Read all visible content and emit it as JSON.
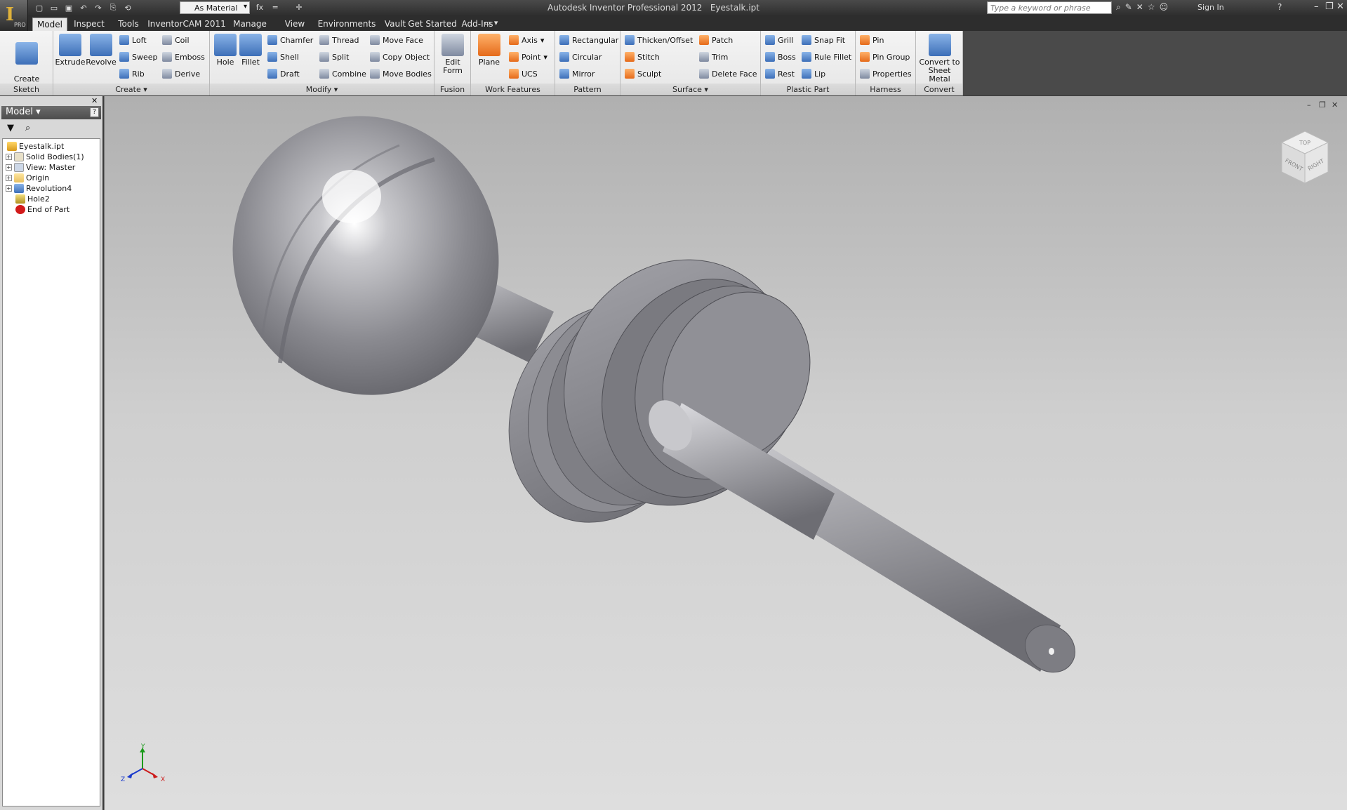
{
  "app": {
    "title": "Autodesk Inventor Professional 2012",
    "document": "Eyestalk.ipt",
    "logo_badge": "PRO",
    "material": "As Material",
    "search_placeholder": "Type a keyword or phrase",
    "sign_in": "Sign In"
  },
  "tabs": [
    "Model",
    "Inspect",
    "Tools",
    "InventorCAM 2011",
    "Manage",
    "View",
    "Environments",
    "Vault",
    "Get Started",
    "Add-Ins"
  ],
  "ribbon": {
    "sketch": {
      "label": "Sketch",
      "create_2d_sketch": "Create\n2D Sketch"
    },
    "create": {
      "label": "Create",
      "extrude": "Extrude",
      "revolve": "Revolve",
      "loft": "Loft",
      "sweep": "Sweep",
      "rib": "Rib",
      "coil": "Coil",
      "emboss": "Emboss",
      "derive": "Derive"
    },
    "modify": {
      "label": "Modify",
      "hole": "Hole",
      "fillet": "Fillet",
      "chamfer": "Chamfer",
      "shell": "Shell",
      "draft": "Draft",
      "thread": "Thread",
      "split": "Split",
      "combine": "Combine",
      "move_face": "Move Face",
      "copy_object": "Copy Object",
      "move_bodies": "Move Bodies"
    },
    "fusion": {
      "label": "Fusion",
      "edit_form": "Edit\nForm"
    },
    "work_features": {
      "label": "Work Features",
      "plane": "Plane",
      "axis": "Axis",
      "point": "Point",
      "ucs": "UCS"
    },
    "pattern": {
      "label": "Pattern",
      "rectangular": "Rectangular",
      "circular": "Circular",
      "mirror": "Mirror"
    },
    "surface": {
      "label": "Surface",
      "thicken_offset": "Thicken/Offset",
      "stitch": "Stitch",
      "sculpt": "Sculpt",
      "patch": "Patch",
      "trim": "Trim",
      "delete_face": "Delete Face"
    },
    "plastic_part": {
      "label": "Plastic Part",
      "grill": "Grill",
      "boss": "Boss",
      "rest": "Rest",
      "snap_fit": "Snap Fit",
      "rule_fillet": "Rule Fillet",
      "lip": "Lip"
    },
    "harness": {
      "label": "Harness",
      "pin": "Pin",
      "pin_group": "Pin Group",
      "properties": "Properties"
    },
    "convert": {
      "label": "Convert",
      "convert_to_sheet_metal": "Convert to\nSheet Metal"
    }
  },
  "browser": {
    "title": "Model",
    "tree": [
      {
        "label": "Eyestalk.ipt"
      },
      {
        "label": "Solid Bodies(1)"
      },
      {
        "label": "View: Master"
      },
      {
        "label": "Origin"
      },
      {
        "label": "Revolution4"
      },
      {
        "label": "Hole2"
      },
      {
        "label": "End of Part"
      }
    ]
  },
  "viewcube": {
    "top": "TOP",
    "front": "FRONT",
    "right": "RIGHT"
  },
  "triad": {
    "x": "X",
    "y": "Y",
    "z": "Z"
  },
  "colors": {
    "accent": "#e0b23a",
    "titlebar": "#3a3a3a",
    "ribbon": "#eeeeee",
    "viewport": "#c8c8c8"
  }
}
